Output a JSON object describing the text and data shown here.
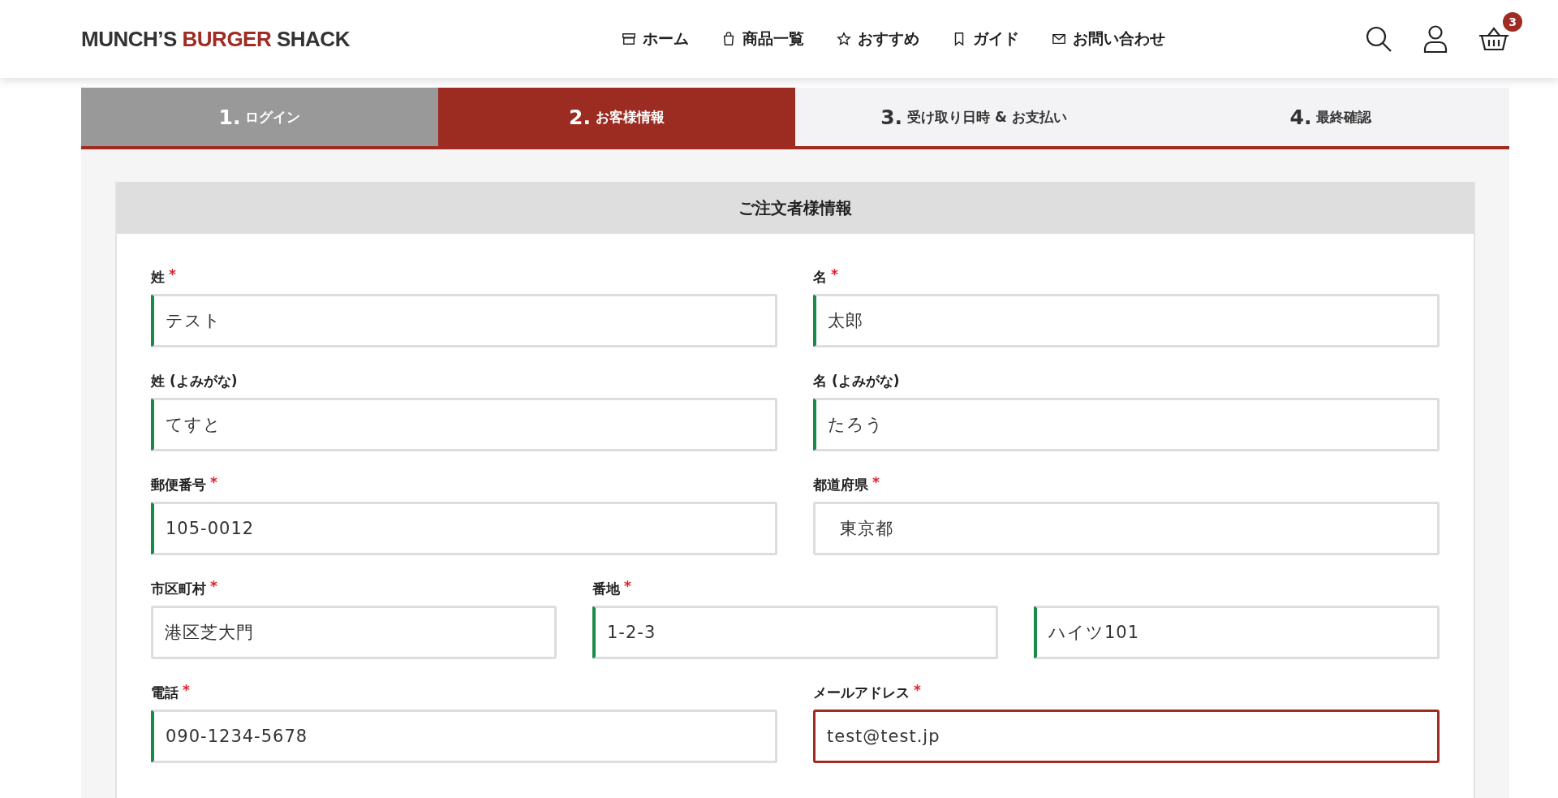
{
  "header": {
    "logo": {
      "part_1": "MUNCH’S",
      "part_2": "BURGER",
      "part_3": "SHACK"
    },
    "nav": [
      {
        "label": "ホーム"
      },
      {
        "label": "商品一覧"
      },
      {
        "label": "おすすめ"
      },
      {
        "label": "ガイド"
      },
      {
        "label": "お問い合わせ"
      }
    ],
    "cart_count": "3"
  },
  "steps": [
    {
      "number": "1.",
      "label": "ログイン",
      "selected": false,
      "completed": true
    },
    {
      "number": "2.",
      "label": "お客様情報",
      "selected": true,
      "completed": false
    },
    {
      "number": "3.",
      "label": "受け取り日時 & お支払い",
      "selected": false,
      "completed": false
    },
    {
      "number": "4.",
      "label": "最終確認",
      "selected": false,
      "completed": false
    }
  ],
  "form": {
    "title": "ご注文者様情報",
    "rows": [
      [
        {
          "label": "姓",
          "required_mark": "*",
          "kind": "text",
          "value": "テスト",
          "valid": true,
          "focused": false
        },
        {
          "label": "名",
          "required_mark": "*",
          "kind": "text",
          "value": "太郎",
          "valid": true,
          "focused": false
        }
      ],
      [
        {
          "label": "姓 (よみがな)",
          "kind": "text",
          "value": "てすと",
          "valid": true,
          "focused": false
        },
        {
          "label": "名 (よみがな)",
          "kind": "text",
          "value": "たろう",
          "valid": true,
          "focused": false
        }
      ],
      [
        {
          "label": "郵便番号",
          "required_mark": "*",
          "kind": "text",
          "value": "105-0012",
          "valid": true,
          "focused": false
        },
        {
          "label": "都道府県",
          "required_mark": "*",
          "kind": "select",
          "value": "東京都",
          "valid": false,
          "focused": false
        }
      ],
      [
        {
          "label": "市区町村",
          "required_mark": "*",
          "kind": "text",
          "value": "港区芝大門",
          "valid": false,
          "focused": false
        },
        {
          "label": "番地",
          "required_mark": "*",
          "kind": "text",
          "value": "1-2-3",
          "valid": true,
          "focused": false
        },
        {
          "kind": "text",
          "value": "ハイツ101",
          "valid": true,
          "focused": false
        }
      ],
      [
        {
          "label": "電話",
          "required_mark": "*",
          "kind": "text",
          "value": "090-1234-5678",
          "valid": true,
          "focused": false
        },
        {
          "label": "メールアドレス",
          "required_mark": "*",
          "kind": "text",
          "value": "test@test.jp",
          "valid": false,
          "focused": true
        }
      ]
    ]
  }
}
